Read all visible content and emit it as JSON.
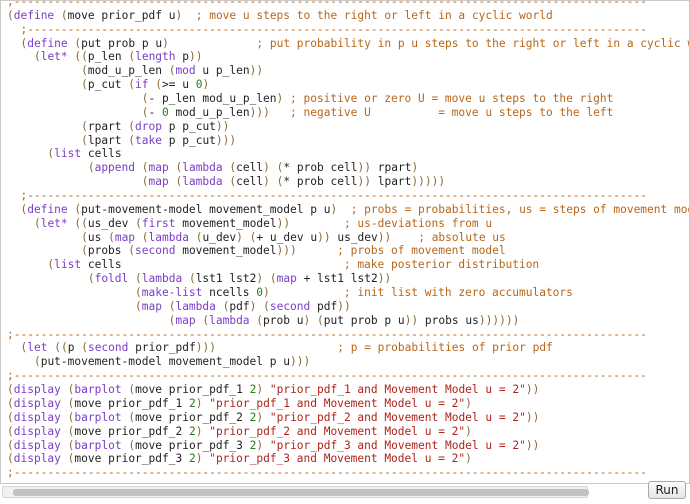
{
  "editor": {
    "lines": [
      ";----------------------------------------------------------------------------------------------",
      "(define (move prior_pdf u)  ; move u steps to the right or left in a cyclic world",
      "  ;--------------------------------------------------------------------------------------------",
      "  (define (put prob p u)             ; put probability in p u steps to the right or left in a cyclic world",
      "    (let* ((p_len (length p))",
      "           (mod_u_p_len (mod u p_len))",
      "           (p_cut (if (>= u 0)",
      "                    (- p_len mod_u_p_len) ; positive or zero U = move u steps to the right",
      "                    (- 0 mod_u_p_len)))   ; negative U          = move u steps to the left",
      "           (rpart (drop p p_cut))",
      "           (lpart (take p p_cut)))",
      "      (list cells",
      "            (append (map (lambda (cell) (* prob cell)) rpart)",
      "                    (map (lambda (cell) (* prob cell)) lpart)))))",
      "  ;--------------------------------------------------------------------------------------------",
      "  (define (put-movement-model movement_model p u)  ; probs = probabilities, us = steps of movement model",
      "    (let* ((us_dev (first movement_model))        ; us-deviations from u",
      "           (us (map (lambda (u_dev) (+ u_dev u)) us_dev))    ; absolute us",
      "           (probs (second movement_model)))      ; probs of movement model",
      "      (list cells                                 ; make posterior distribution",
      "            (foldl (lambda (lst1 lst2) (map + lst1 lst2))",
      "                   (make-list ncells 0)           ; init list with zero accumulators",
      "                   (map (lambda (pdf) (second pdf))",
      "                        (map (lambda (prob u) (put prob p u)) probs us))))))",
      ";----------------------------------------------------------------------------------------------",
      "  (let ((p (second prior_pdf)))                  ; p = probabilities of prior pdf",
      "    (put-movement-model movement_model p u)))",
      ";----------------------------------------------------------------------------------------------",
      "(display (barplot (move prior_pdf_1 2) \"prior_pdf_1 and Movement Model u = 2\"))",
      "(display (move prior_pdf_1 2) \"prior_pdf_1 and Movement Model u = 2\")",
      "(display (barplot (move prior_pdf_2 2) \"prior_pdf_2 and Movement Model u = 2\"))",
      "(display (move prior_pdf_2 2) \"prior_pdf_2 and Movement Model u = 2\")",
      "(display (barplot (move prior_pdf_3 2) \"prior_pdf_3 and Movement Model u = 2\"))",
      "(display (move prior_pdf_3 2) \"prior_pdf_3 and Movement Model u = 2\")",
      ";----------------------------------------------------------------------------------------------"
    ]
  },
  "toolbar": {
    "run_label": "Run"
  },
  "colors": {
    "comment": "#b8661a",
    "keyword": "#7a3ec6",
    "string": "#b0221a",
    "number": "#2a7a1c",
    "bracket": "#8a6a3a"
  }
}
